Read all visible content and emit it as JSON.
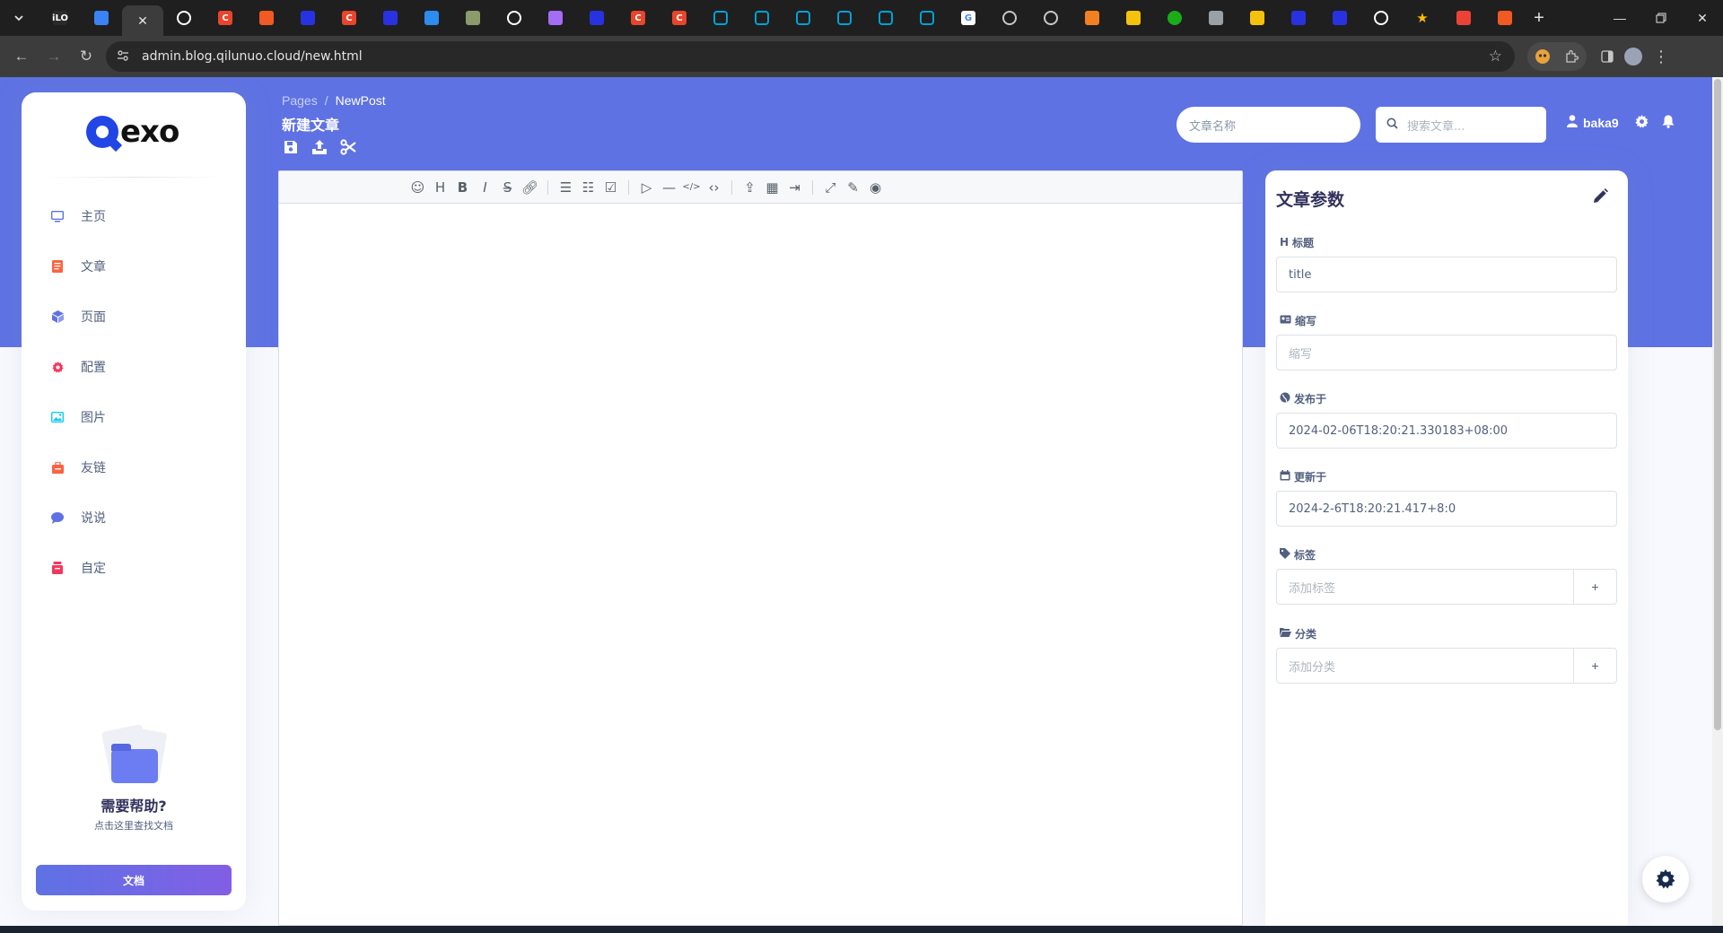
{
  "browser": {
    "url": "admin.blog.qilunuo.cloud/new.html",
    "tab_favicons": [
      {
        "icon": "ilo-icon",
        "label": "iLO",
        "color": "#2b2b2b"
      },
      {
        "icon": "tab-copy-icon",
        "label": "",
        "color": "#3b82f6"
      },
      {
        "icon": "active-tab-close-icon",
        "label": "",
        "color": "#3c3c3c"
      },
      {
        "icon": "github-icon",
        "label": "",
        "color": "#ffffff"
      },
      {
        "icon": "c-icon",
        "label": "C",
        "color": "#e8452c"
      },
      {
        "icon": "shield-icon",
        "label": "",
        "color": "#f15a22"
      },
      {
        "icon": "paw-icon",
        "label": "",
        "color": "#2932e1"
      },
      {
        "icon": "c-icon",
        "label": "C",
        "color": "#e8452c"
      },
      {
        "icon": "paw-icon",
        "label": "",
        "color": "#2932e1"
      },
      {
        "icon": "image-icon",
        "label": "",
        "color": "#2d8cf0"
      },
      {
        "icon": "photo-icon",
        "label": "",
        "color": "#8b9b6a"
      },
      {
        "icon": "github-icon",
        "label": "",
        "color": "#ffffff"
      },
      {
        "icon": "purple-square-icon",
        "label": "",
        "color": "#a56cf5"
      },
      {
        "icon": "paw-icon",
        "label": "",
        "color": "#2932e1"
      },
      {
        "icon": "c-icon",
        "label": "C",
        "color": "#e8452c"
      },
      {
        "icon": "c-icon",
        "label": "C",
        "color": "#e8452c"
      },
      {
        "icon": "bilibili-icon",
        "label": "",
        "color": "#00a1d6"
      },
      {
        "icon": "bilibili-icon",
        "label": "",
        "color": "#00a1d6"
      },
      {
        "icon": "bilibili-icon",
        "label": "",
        "color": "#00a1d6"
      },
      {
        "icon": "bilibili-icon",
        "label": "",
        "color": "#00a1d6"
      },
      {
        "icon": "bilibili-icon",
        "label": "",
        "color": "#00a1d6"
      },
      {
        "icon": "bilibili-icon",
        "label": "",
        "color": "#00a1d6"
      },
      {
        "icon": "google-icon",
        "label": "G",
        "color": "#4285f4"
      },
      {
        "icon": "globe-icon",
        "label": "",
        "color": "#c7c7c7"
      },
      {
        "icon": "globe-icon",
        "label": "",
        "color": "#c7c7c7"
      },
      {
        "icon": "cloud-icon",
        "label": "",
        "color": "#f38020"
      },
      {
        "icon": "mail-icon",
        "label": "",
        "color": "#f4c20d"
      },
      {
        "icon": "green-circle-icon",
        "label": "",
        "color": "#1aad19"
      },
      {
        "icon": "gear-icon",
        "label": "",
        "color": "#9aa0a6"
      },
      {
        "icon": "mail-icon",
        "label": "",
        "color": "#f4c20d"
      },
      {
        "icon": "paw-icon",
        "label": "",
        "color": "#2932e1"
      },
      {
        "icon": "paw-icon",
        "label": "",
        "color": "#2932e1"
      },
      {
        "icon": "github-icon",
        "label": "",
        "color": "#ffffff"
      },
      {
        "icon": "star-icon",
        "label": "",
        "color": "#fbbc04"
      },
      {
        "icon": "chrome-icon",
        "label": "",
        "color": "#ea4335"
      },
      {
        "icon": "shield-icon",
        "label": "",
        "color": "#f15a22"
      }
    ]
  },
  "sidebar": {
    "logo_text": "exo",
    "items": [
      {
        "label": "主页",
        "icon": "monitor-icon",
        "color": "#5e72e4"
      },
      {
        "label": "文章",
        "icon": "article-icon",
        "color": "#fb6340"
      },
      {
        "label": "页面",
        "icon": "cube-icon",
        "color": "#5e72e4"
      },
      {
        "label": "配置",
        "icon": "gear-icon",
        "color": "#f5365c"
      },
      {
        "label": "图片",
        "icon": "image-icon",
        "color": "#11cdef"
      },
      {
        "label": "友链",
        "icon": "link-icon",
        "color": "#fb6340"
      },
      {
        "label": "说说",
        "icon": "chat-icon",
        "color": "#5e72e4"
      },
      {
        "label": "自定",
        "icon": "box-icon",
        "color": "#f5365c"
      }
    ],
    "help_title": "需要帮助?",
    "help_sub": "点击这里查找文档",
    "docs_button": "文档"
  },
  "header": {
    "breadcrumb_root": "Pages",
    "breadcrumb_sep": "/",
    "breadcrumb_current": "NewPost",
    "page_title": "新建文章",
    "name_placeholder": "文章名称",
    "search_placeholder": "搜索文章...",
    "username": "baka9"
  },
  "editor": {
    "toolbar": [
      [
        "emoji-icon",
        "heading-icon",
        "bold-icon",
        "italic-icon",
        "strikethrough-icon",
        "link-icon"
      ],
      [
        "unordered-list-icon",
        "ordered-list-icon",
        "checklist-icon"
      ],
      [
        "quote-icon",
        "horizontal-rule-icon",
        "inline-code-icon",
        "code-block-icon"
      ],
      [
        "upload-icon",
        "table-icon",
        "insert-after-icon"
      ],
      [
        "fullscreen-icon",
        "edit-mode-icon",
        "preview-icon"
      ]
    ],
    "content": ""
  },
  "params": {
    "title": "文章参数",
    "fields": {
      "title": {
        "label": "标题",
        "value": "title"
      },
      "abbr": {
        "label": "缩写",
        "placeholder": "缩写"
      },
      "published": {
        "label": "发布于",
        "value": "2024-02-06T18:20:21.330183+08:00"
      },
      "updated": {
        "label": "更新于",
        "value": "2024-2-6T18:20:21.417+8:0"
      },
      "tags": {
        "label": "标签",
        "placeholder": "添加标签",
        "button": "+"
      },
      "category": {
        "label": "分类",
        "placeholder": "添加分类",
        "button": "+"
      }
    }
  }
}
